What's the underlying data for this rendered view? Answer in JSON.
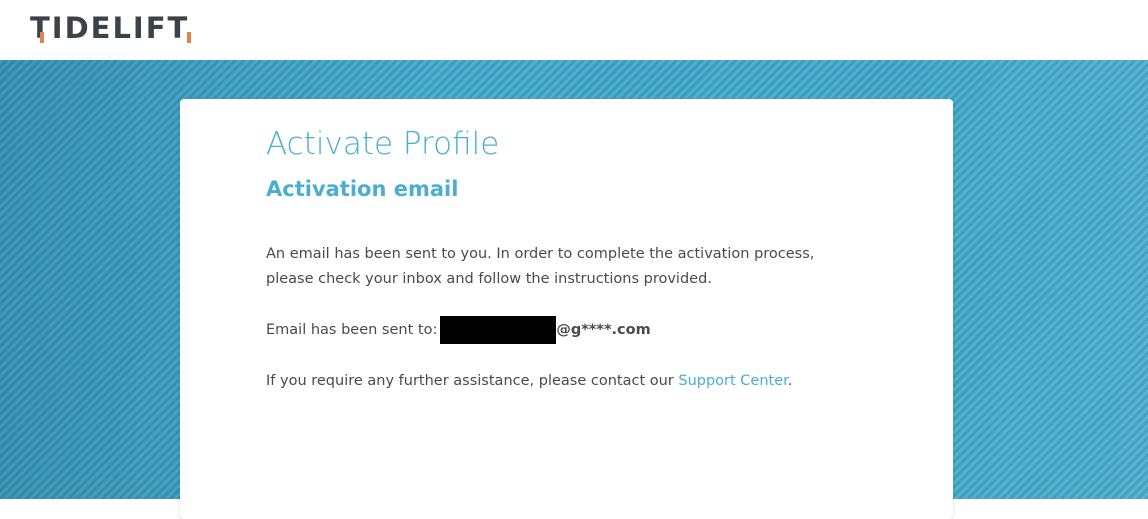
{
  "header": {
    "logo_text": "TIDELIFT",
    "accent_color": "#e0834b"
  },
  "card": {
    "title": "Activate Profile",
    "subtitle": "Activation email",
    "paragraph1": "An email has been sent to you. In order to complete the activation process, please check your inbox and follow the instructions provided.",
    "email_label": "Email has been sent to:",
    "email_domain": "@g****.com",
    "assist_prefix": "If you require any further assistance, please contact our ",
    "support_link": "Support Center",
    "assist_suffix": "."
  },
  "colors": {
    "accent_blue": "#4aaed0",
    "background_blue": "#45a6c7",
    "text": "#4a4a4a"
  }
}
